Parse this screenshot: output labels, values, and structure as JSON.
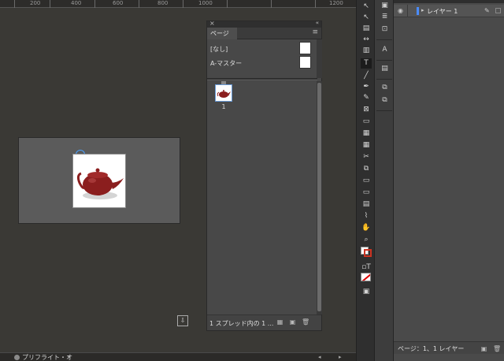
{
  "ruler": {
    "labels": [
      "200",
      "400",
      "600",
      "800",
      "1000",
      "1200"
    ]
  },
  "pages_panel": {
    "close_glyph": "×",
    "collapse_glyph": "«",
    "tab_label": "ページ",
    "menu_glyph": "≡",
    "masters": [
      {
        "label": "[なし]"
      },
      {
        "label": "A-マスター"
      }
    ],
    "page_number": "1",
    "footer_text": "1 スプレッド内の 1 ..."
  },
  "status_bar": {
    "preflight_text": "プリフライト・オ",
    "arrow": "▾"
  },
  "layers_panel": {
    "layer_name": "レイヤー 1",
    "footer_text": "ページ：1、1 レイヤー"
  },
  "icons": {
    "selection": "selection-arrow-icon",
    "direct_selection": "direct-selection-icon",
    "type": "type-tool-icon"
  },
  "colors": {
    "accent": "#4a8cff",
    "teapot": "#8b1e1e"
  }
}
